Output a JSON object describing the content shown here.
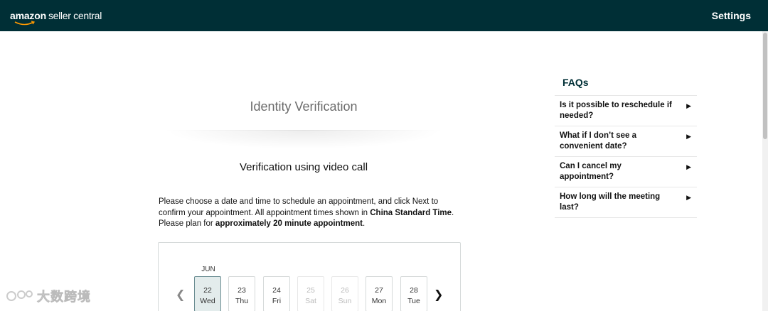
{
  "header": {
    "logo_bold": "amazon",
    "logo_rest": "seller central",
    "settings_label": "Settings"
  },
  "main": {
    "title": "Identity Verification",
    "subtitle": "Verification using video call",
    "desc_part1": "Please choose a date and time to schedule an appointment, and click Next to confirm your appointment. All appointment times shown in ",
    "desc_bold1": "China Standard Time",
    "desc_part2": ". Please plan for ",
    "desc_bold2": "approximately 20 minute appointment",
    "desc_part3": "."
  },
  "calendar": {
    "month": "JUN",
    "prev_icon": "chevron-left-icon",
    "next_icon": "chevron-right-icon",
    "days": [
      {
        "date": "22",
        "weekday": "Wed",
        "state": "selected"
      },
      {
        "date": "23",
        "weekday": "Thu",
        "state": "available"
      },
      {
        "date": "24",
        "weekday": "Fri",
        "state": "available"
      },
      {
        "date": "25",
        "weekday": "Sat",
        "state": "disabled"
      },
      {
        "date": "26",
        "weekday": "Sun",
        "state": "disabled"
      },
      {
        "date": "27",
        "weekday": "Mon",
        "state": "available"
      },
      {
        "date": "28",
        "weekday": "Tue",
        "state": "available"
      }
    ]
  },
  "faq": {
    "title": "FAQs",
    "items": [
      {
        "question": "Is it possible to reschedule if needed?"
      },
      {
        "question": "What if I don’t see a convenient date?"
      },
      {
        "question": "Can I cancel my appointment?"
      },
      {
        "question": "How long will the meeting last?"
      }
    ]
  },
  "watermark": {
    "text": "大数跨境"
  },
  "colors": {
    "header_bg": "#002f36",
    "selected_day_bg": "#e3ecec",
    "faq_title": "#002f36"
  }
}
